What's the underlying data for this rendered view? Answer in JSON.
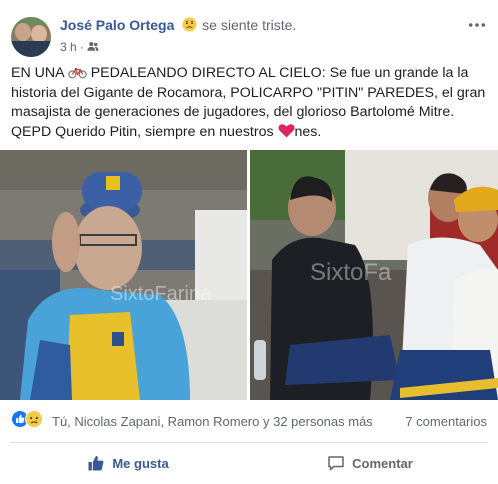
{
  "author": {
    "name": "José Palo Ortega",
    "feeling": "se siente triste.",
    "feeling_icon": "sad-face-icon"
  },
  "meta": {
    "time": "3 h",
    "separator": "·",
    "audience_icon": "friends-icon"
  },
  "post": {
    "text_part1": "EN UNA ",
    "bicycle_icon": "bicycle-icon",
    "text_part2": " PEDALEANDO DIRECTO AL CIELO: Se fue un grande la la historia del Gigante de Rocamora, POLICARPO \"PITIN\" PAREDES, el gran masajista de generaciones de jugadores, del glorioso Bartolomé Mitre. QEPD Querido Pitin, siempre en nuestros ",
    "heart_icon": "heart-icon",
    "text_part3": "nes."
  },
  "photos": {
    "left_watermark": "SixtoFarina",
    "right_watermark": "SixtoFa"
  },
  "reactions": {
    "icons": [
      "like-reaction-icon",
      "sad-reaction-icon"
    ],
    "summary": "Tú, Nicolas Zapani, Ramon Romero y 32 personas más",
    "comments": "7 comentarios"
  },
  "actions": {
    "like_label": "Me gusta",
    "comment_label": "Comentar"
  },
  "colors": {
    "link_blue": "#385898",
    "secondary_text": "#606770",
    "divider": "#dadde1",
    "heart_red": "#e0245e"
  }
}
